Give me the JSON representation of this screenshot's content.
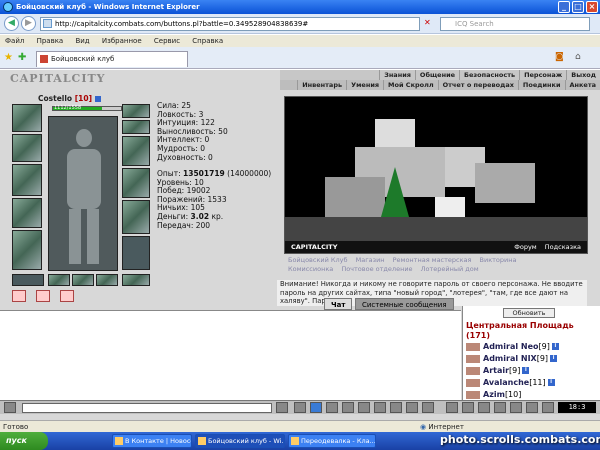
{
  "window": {
    "title": "Бойцовский клуб - Windows Internet Explorer",
    "minimize": "_",
    "maximize": "□",
    "close": "×"
  },
  "browser": {
    "url": "http://capitalcity.combats.com/buttons.pl?battle=0.349528904838639#",
    "search_placeholder": "ICQ Search",
    "menu": [
      "Файл",
      "Правка",
      "Вид",
      "Избранное",
      "Сервис",
      "Справка"
    ],
    "tab_title": "Бойцовский клуб",
    "status": "Готово",
    "zone": "Интернет"
  },
  "game": {
    "logo": "CAPITALCITY",
    "top_menu_row1": [
      "Знания",
      "Общение",
      "Безопасность",
      "Персонаж",
      "Выход"
    ],
    "top_menu_row2": [
      "Инвентарь",
      "Умения",
      "Мой Скролл",
      "Отчет о переводах",
      "Поединки",
      "Анкета"
    ],
    "character": {
      "name": "Costello",
      "level": "[10]",
      "hp": "1112/1558",
      "hp_fraction": 0.714
    },
    "stats": [
      "Сила: 25",
      "Ловкость: 3",
      "Интуиция: 122",
      "Выносливость: 50",
      "Интеллект: 0",
      "Мудрость: 0",
      "Духовность: 0"
    ],
    "exp_label": "Опыт:",
    "exp_value": "13501719",
    "exp_next": "(14000000)",
    "info": [
      "Уровень: 10",
      "Побед: 19002",
      "Поражений: 1533",
      "Ничьих: 105"
    ],
    "money_label": "Деньги:",
    "money_value": "3.02",
    "money_unit": "кр.",
    "transfers": "Передач: 200",
    "scene_logo": "CAPITALCITY",
    "scene_links": [
      "Форум",
      "Подсказка"
    ],
    "links": [
      "Бойцовский Клуб",
      "Магазин",
      "Ремонтная мастерская",
      "Викторина",
      "Комиссионка",
      "Почтовое отделение",
      "Лотерейный дом"
    ],
    "warning": "Внимание! Никогда и никому не говорите пароль от своего персонажа. Не вводите пароль на других сайтах, типа \"новый город\", \"лотерея\", \"там, где все дают на халяву\". Пароль не",
    "chat_tabs": [
      "Чат",
      "Системные сообщения"
    ],
    "refresh_button": "Обновить",
    "location": "Центральная Площадь",
    "online_count": "(171)",
    "users": [
      {
        "name": "Admiral Neo",
        "level": "[9]"
      },
      {
        "name": "Admiral NIX",
        "level": "[9]"
      },
      {
        "name": "Artair",
        "level": "[9]"
      },
      {
        "name": "Avalanche",
        "level": "[11]"
      },
      {
        "name": "Azim",
        "level": "[10]"
      }
    ],
    "clock": "18:3"
  },
  "taskbar": {
    "start": "пуск",
    "tasks": [
      "В Контакте | Новосо...",
      "Бойцовский клуб - Wi...",
      "Переодевалка - Клa..."
    ]
  },
  "watermark": "photo.scrolls.combats.com"
}
